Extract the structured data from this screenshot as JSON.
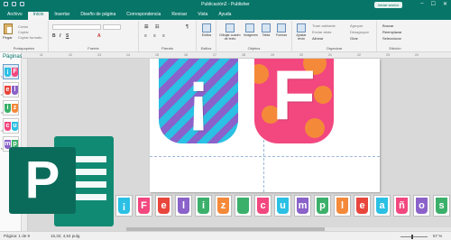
{
  "titlebar": {
    "title": "Publicación2 - Publisher",
    "user": "Iniciar sesión"
  },
  "tabs": [
    "Archivo",
    "Inicio",
    "Insertar",
    "Diseño de página",
    "Correspondencia",
    "Revisar",
    "Vista",
    "Ayuda"
  ],
  "ribbon": {
    "clipboard": {
      "paste": "Pegar",
      "cut": "Cortar",
      "copy": "Copiar",
      "copy_format": "Copiar formato",
      "label": "Portapapeles"
    },
    "font": {
      "label": "Fuente"
    },
    "paragraph": {
      "label": "Párrafo"
    },
    "styles": {
      "button": "Estilos",
      "label": "Estilos"
    },
    "objects": {
      "draw_textbox": "Dibujar cuadro de texto",
      "images": "Imágenes",
      "table": "Tabla",
      "shapes": "Formas",
      "label": "Objetos"
    },
    "organize": {
      "wrap_text": "Ajustar texto",
      "bring_forward": "Traer adelante",
      "send_backward": "Enviar atrás",
      "align": "Alinear",
      "group": "Agrupar",
      "ungroup": "Desagrupar",
      "rotate": "Girar",
      "label": "Organizar"
    },
    "edit": {
      "find": "Buscar",
      "replace": "Reemplazar",
      "select": "Seleccionar",
      "label": "Edición"
    }
  },
  "pages_pane": {
    "title": "Páginas",
    "page_nums": [
      "1",
      "2",
      "3",
      "4",
      "5"
    ]
  },
  "ruler": [
    "11",
    "12",
    "13",
    "14",
    "15",
    "16",
    "17",
    "18",
    "19",
    "20",
    "21",
    "22",
    "23",
    "24"
  ],
  "banners": [
    {
      "letter": "¡",
      "style": "stripes"
    },
    {
      "letter": "F",
      "style": "dots"
    }
  ],
  "logo_letter": "P",
  "strip_tiles": [
    "¡",
    "F",
    "e",
    "l",
    "i",
    "z",
    "",
    "c",
    "u",
    "m",
    "p",
    "l",
    "e",
    "a",
    "ñ",
    "o",
    "s",
    "!"
  ],
  "status": {
    "page": "Página: 1 de 9",
    "position": "15,32; 4,54 pulg.",
    "zoom": "57 %"
  },
  "colors": {
    "accent": "#077568",
    "pink": "#f2477f",
    "cyan": "#2bc0e4",
    "purple": "#8a62c9",
    "orange": "#f5893a",
    "green": "#3bb06a",
    "red": "#e8453c"
  }
}
